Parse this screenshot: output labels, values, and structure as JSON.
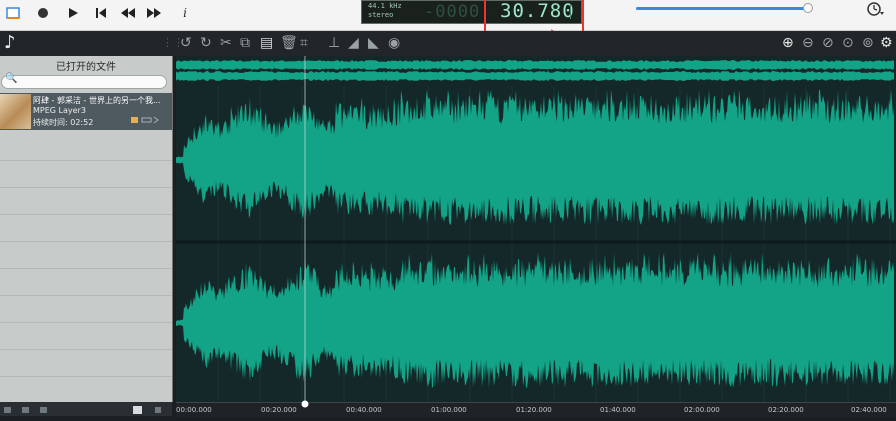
{
  "toolbar_top": {
    "info_label": "i",
    "history_icon": "history-icon"
  },
  "display": {
    "sample_rate": "44.1 kHz",
    "channels": "stereo",
    "ghost_digits": "-0000",
    "time_value": "30.780"
  },
  "sidebar": {
    "title": "已打开的文件",
    "search_icon": "🔍",
    "file": {
      "name": "阿肆 - 郭采洁 - 世界上的另一个我...",
      "type": "MPEG Layer3",
      "duration": "持续时间: 02:52"
    }
  },
  "timeline": {
    "labels": [
      "00:00.000",
      "00:20.000",
      "00:40.000",
      "01:00.000",
      "01:20.000",
      "01:40.000",
      "02:00.000",
      "02:20.000",
      "02:40.000"
    ]
  },
  "colors": {
    "waveform": "#13a386",
    "background": "#14282a",
    "highlight": "#e53630"
  }
}
